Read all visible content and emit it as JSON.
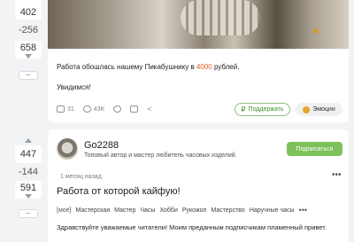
{
  "posts": [
    {
      "rating": {
        "total": "402",
        "down": "-256",
        "up": "658"
      },
      "paragraphs": {
        "p1_prefix": "Работа обошлась нашему Пикабушнику в ",
        "p1_highlight": "4000",
        "p1_suffix": " рублей.",
        "p2": "Увидимся!"
      },
      "footer": {
        "comments": "31",
        "views": "43K"
      },
      "buttons": {
        "support": "Поддержать",
        "emotion": "Эмоции"
      }
    },
    {
      "rating": {
        "total": "447",
        "down": "-144",
        "up": "591"
      },
      "author": {
        "name": "Go2288",
        "description": "Топовый автор и мастер любитель часовых изделий."
      },
      "subscribe_label": "Подписаться",
      "time": "1 месяц назад",
      "menu": "•••",
      "title": "Работа от которой кайфую!",
      "tags": [
        "[моё]",
        "Мастерская",
        "Мастер",
        "Часы",
        "Хобби",
        "Рукожоп",
        "Мастерство",
        "Наручные часы"
      ],
      "tags_more": "•••",
      "text": "Здравствуйте уважаемые читатели! Моим преданным подписчикам пламенный привет."
    }
  ],
  "rating_more_label": "–"
}
